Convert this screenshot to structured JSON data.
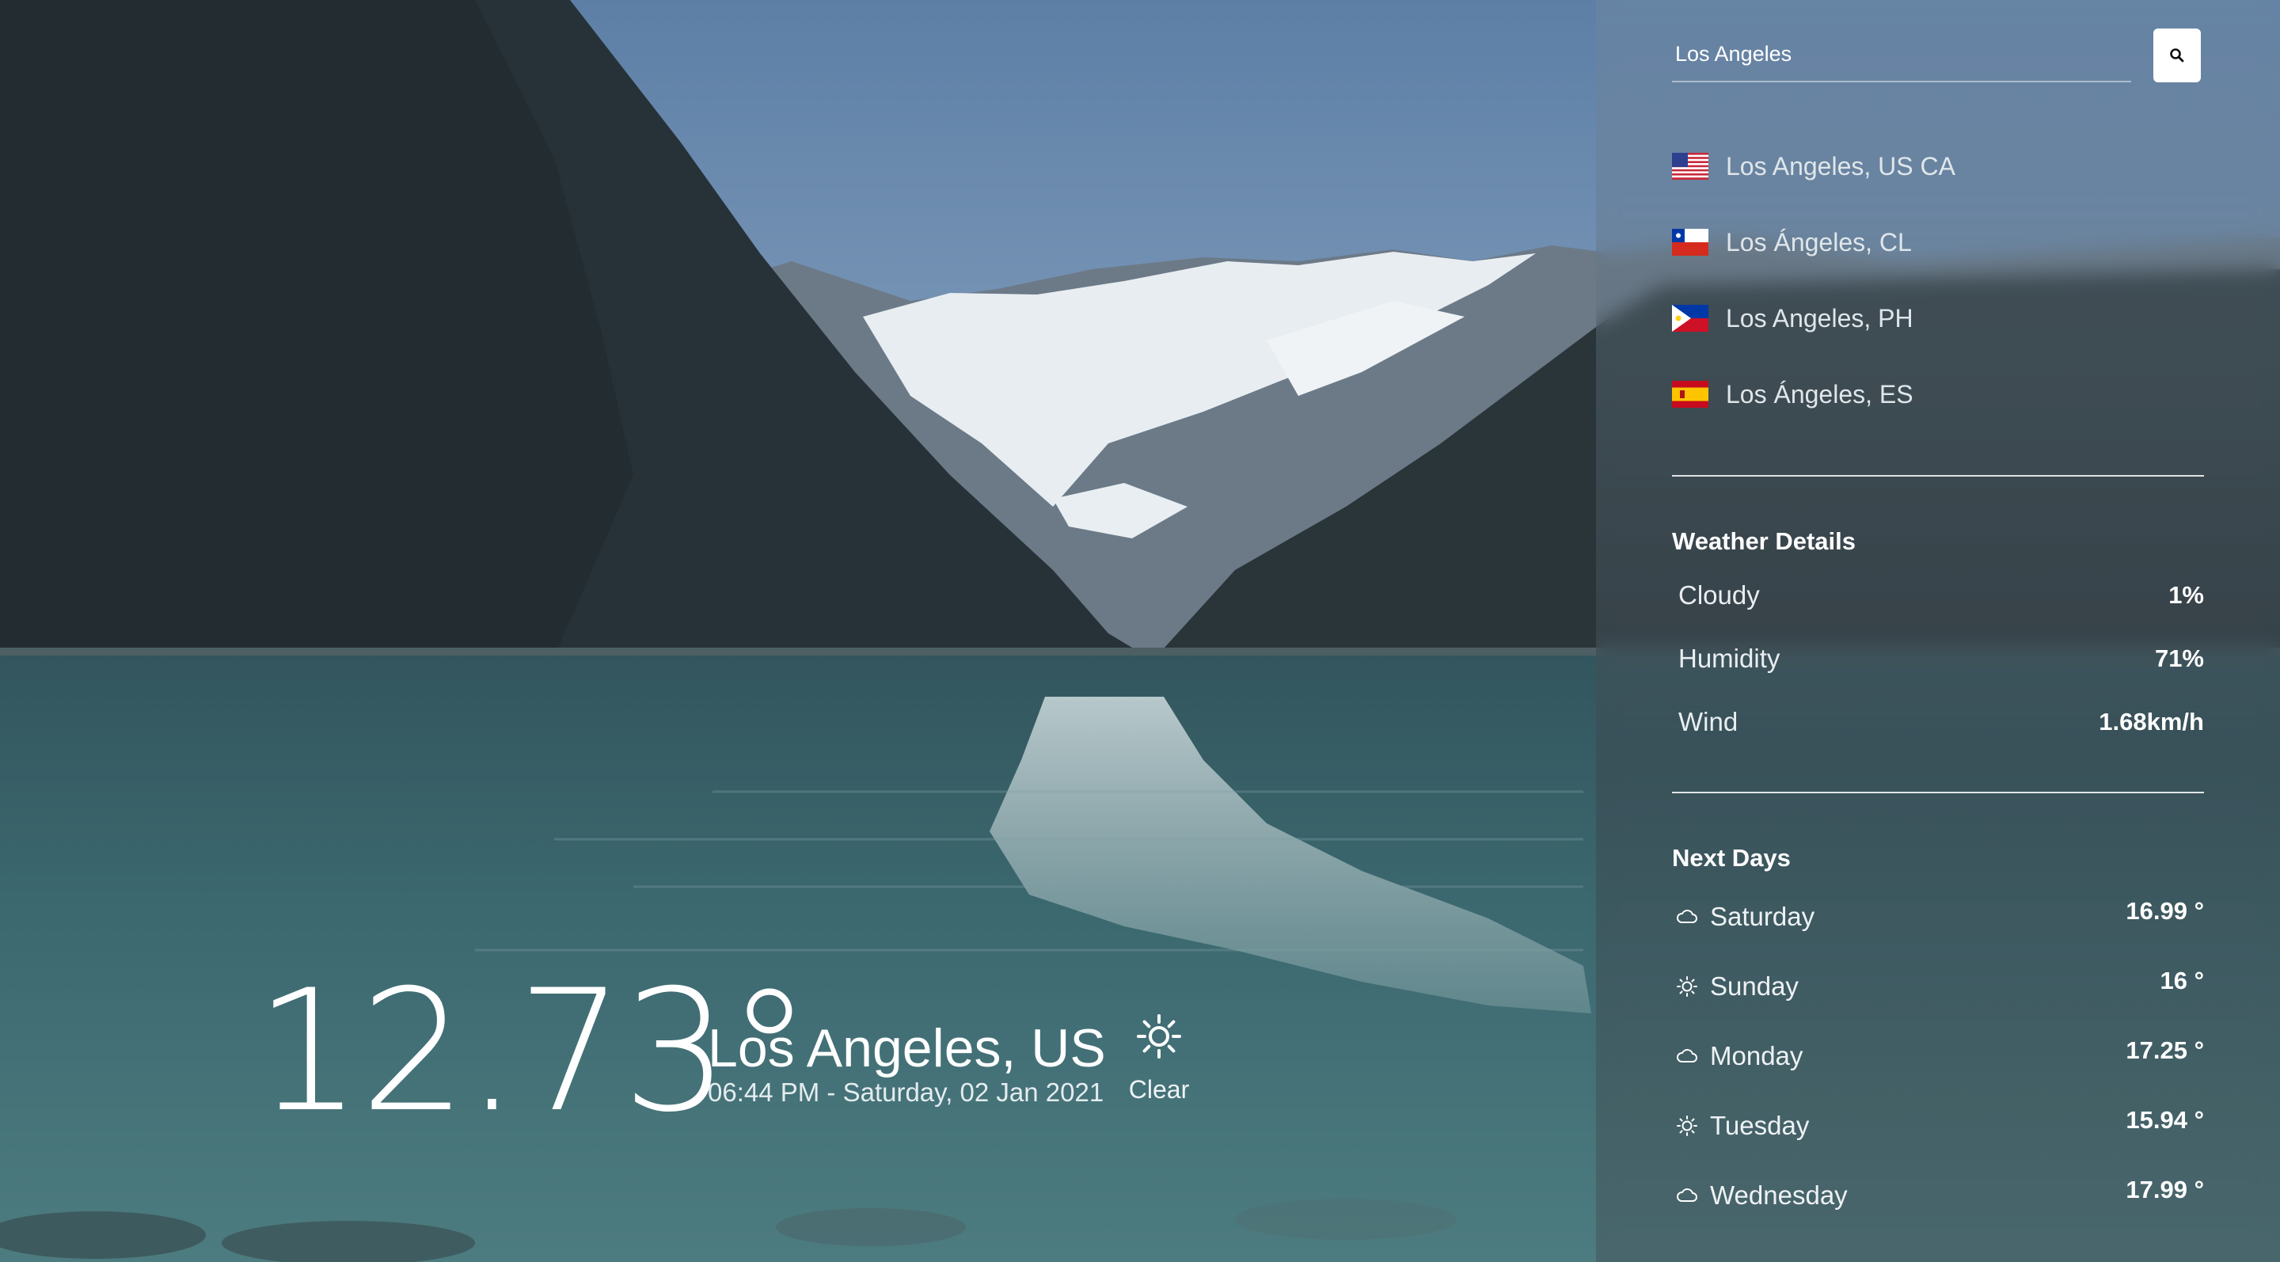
{
  "search": {
    "value": "Los Angeles",
    "button_icon": "search-icon"
  },
  "suggestions": [
    {
      "label": "Los Angeles, US CA",
      "flag": "us"
    },
    {
      "label": "Los Ángeles, CL",
      "flag": "cl"
    },
    {
      "label": "Los Angeles, PH",
      "flag": "ph"
    },
    {
      "label": "Los Ángeles, ES",
      "flag": "es"
    }
  ],
  "details": {
    "title": "Weather Details",
    "rows": [
      {
        "label": "Cloudy",
        "value": "1%"
      },
      {
        "label": "Humidity",
        "value": "71%"
      },
      {
        "label": "Wind",
        "value": "1.68km/h"
      }
    ]
  },
  "next_days": {
    "title": "Next Days",
    "days": [
      {
        "name": "Saturday",
        "temp": "16.99 °",
        "icon": "cloud-icon"
      },
      {
        "name": "Sunday",
        "temp": "16 °",
        "icon": "sun-icon"
      },
      {
        "name": "Monday",
        "temp": "17.25 °",
        "icon": "cloud-icon"
      },
      {
        "name": "Tuesday",
        "temp": "15.94 °",
        "icon": "sun-icon"
      },
      {
        "name": "Wednesday",
        "temp": "17.99 °",
        "icon": "cloud-icon"
      }
    ]
  },
  "current": {
    "temperature": "12.73°",
    "city": "Los Angeles, US",
    "datetime": "06:44 PM - Saturday, 02 Jan 2021",
    "condition": "Clear",
    "condition_icon": "sun-icon"
  }
}
